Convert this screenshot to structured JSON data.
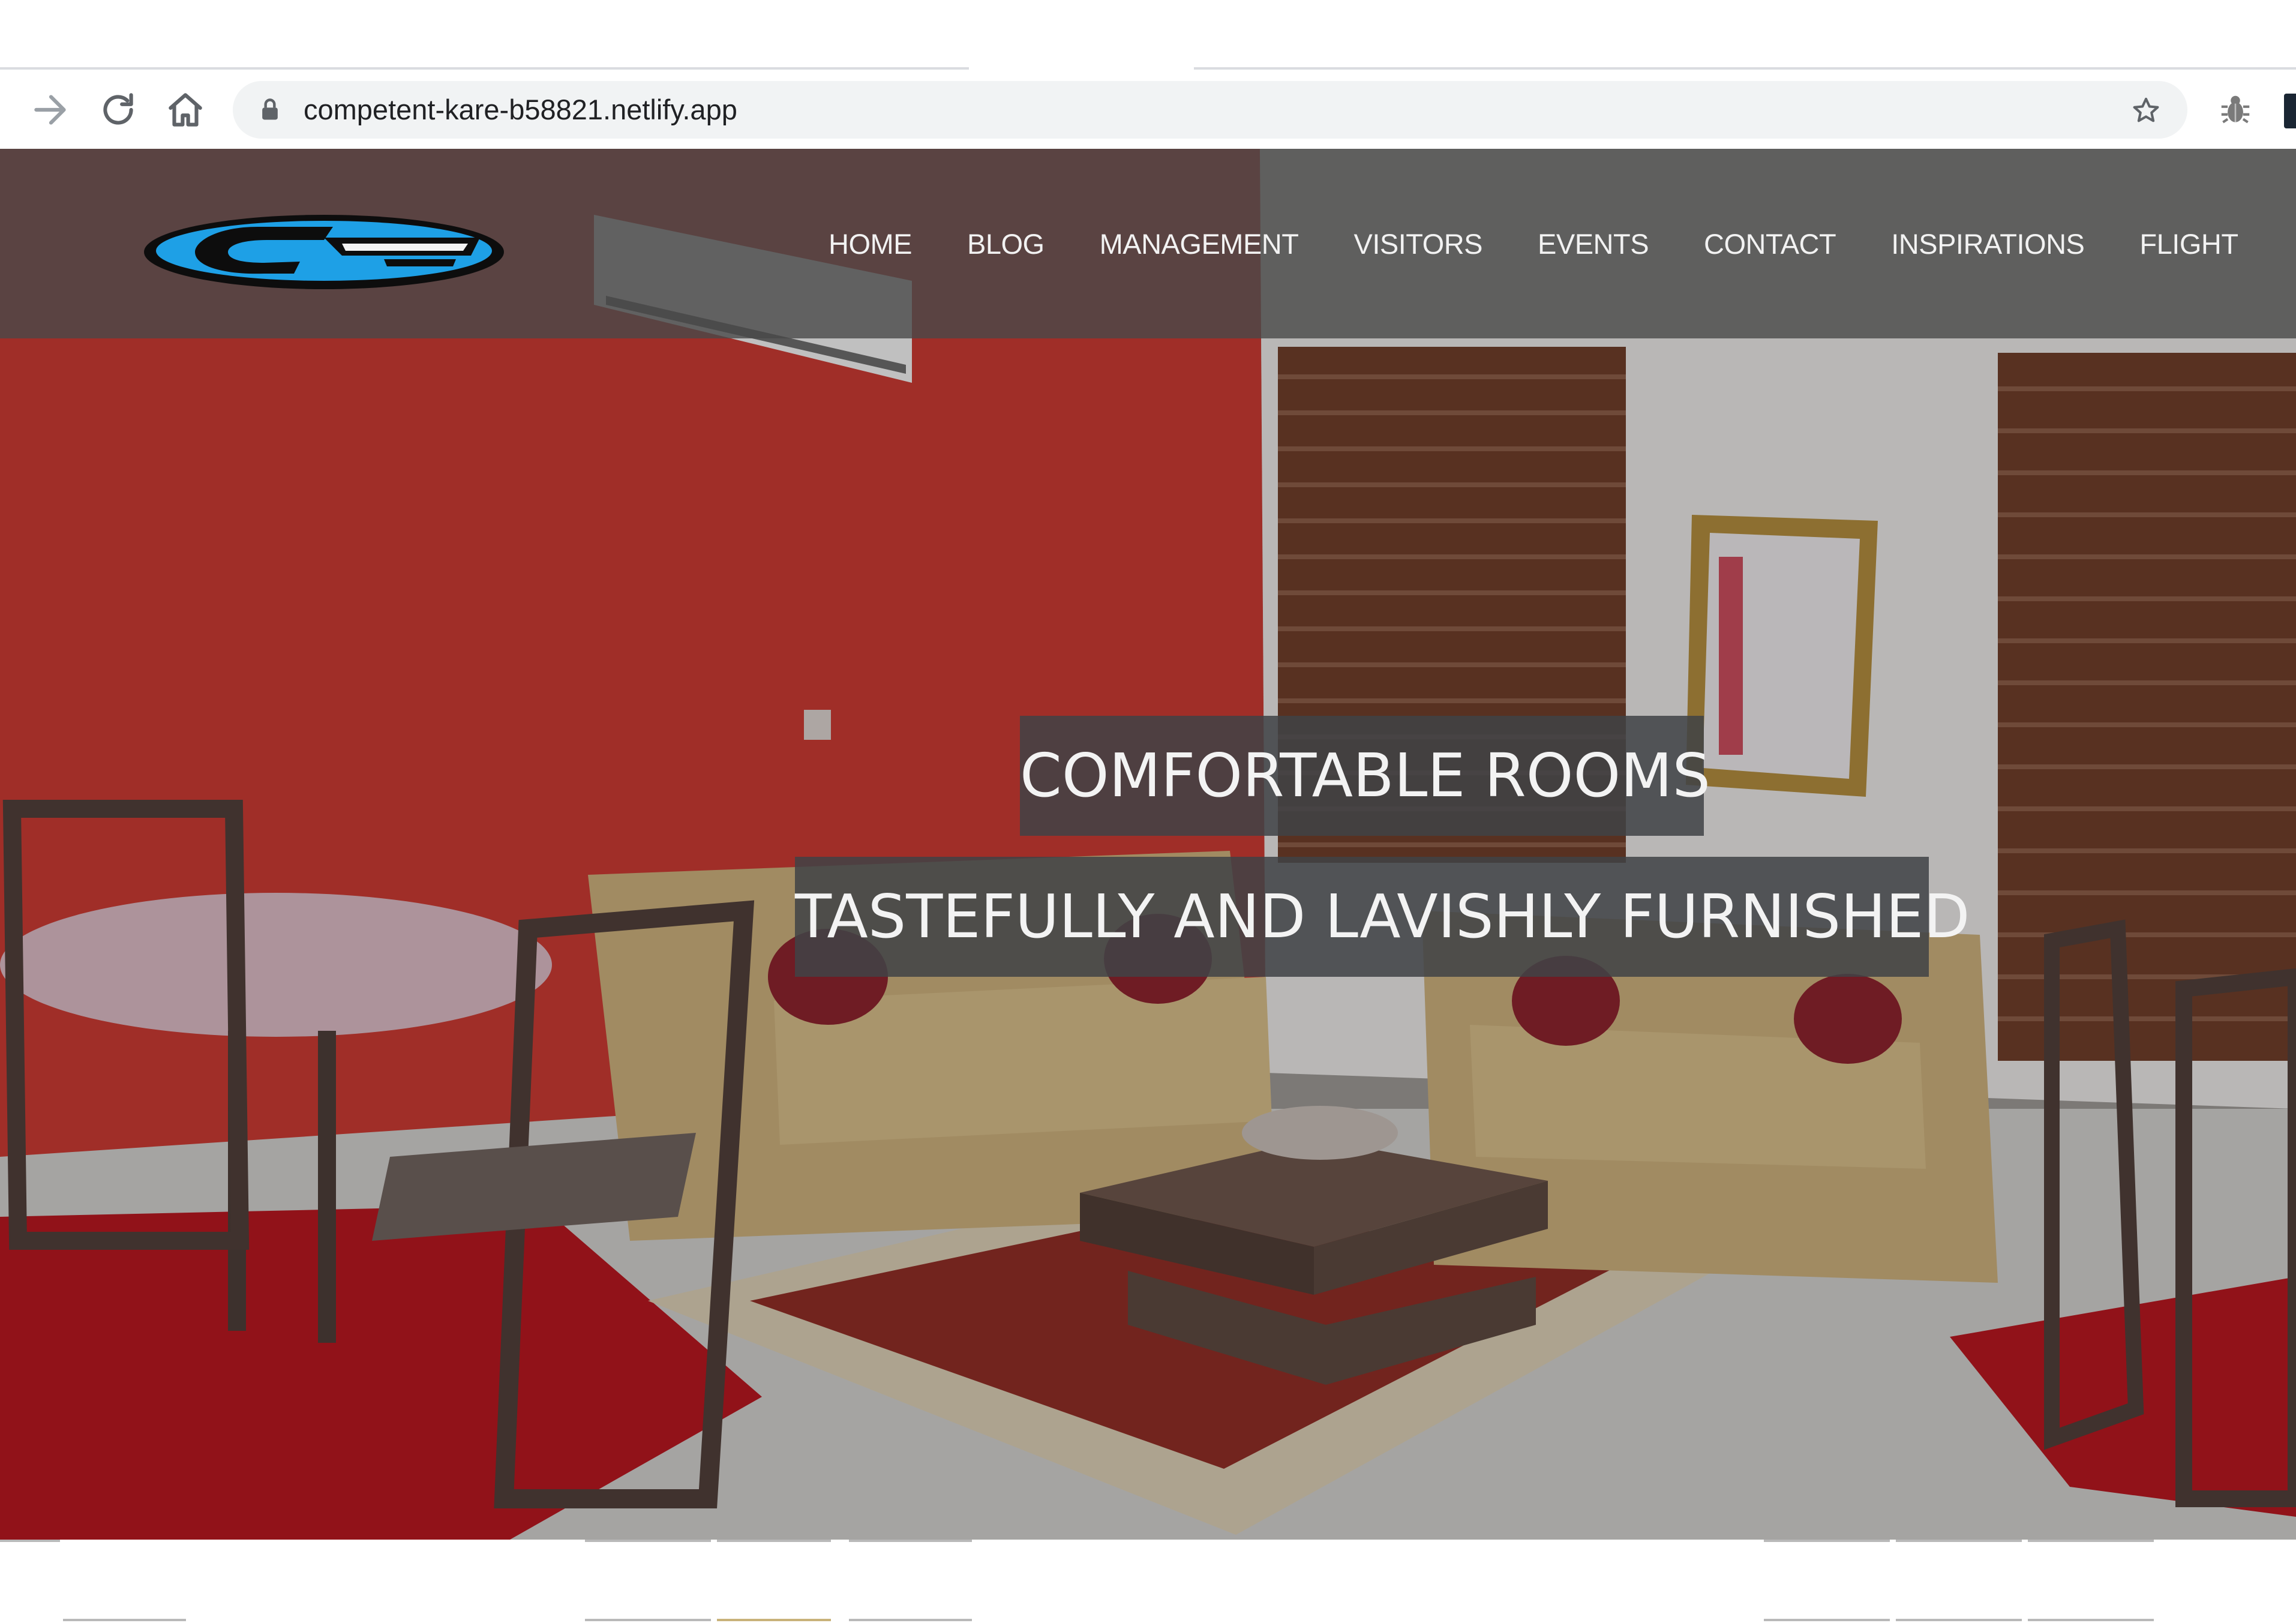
{
  "browser": {
    "url": "competent-kare-b58821.netlify.app",
    "icons": {
      "forward": "arrow-right-icon",
      "reload": "reload-icon",
      "home": "home-icon",
      "lock": "lock-icon",
      "bookmark": "star-icon",
      "extension": "bug-icon",
      "profile": "profile-icon"
    }
  },
  "site": {
    "logo_name": "villa-resort-logo",
    "nav": [
      {
        "label": "HOME"
      },
      {
        "label": "BLOG"
      },
      {
        "label": "MANAGEMENT"
      },
      {
        "label": "VISITORS"
      },
      {
        "label": "EVENTS"
      },
      {
        "label": "CONTACT"
      },
      {
        "label": "INSPIRATIONS"
      },
      {
        "label": "FLIGHT"
      }
    ],
    "hero": {
      "caption_1": "COMFORTABLE ROOMS",
      "caption_2": "TASTEFULLY AND LAVISHLY FURNISHED"
    }
  },
  "colors": {
    "navbar_bg": "#484848",
    "caption_bg": "#404246",
    "accent_wall": "#c8372f",
    "logo_blue": "#1ea0e6"
  }
}
